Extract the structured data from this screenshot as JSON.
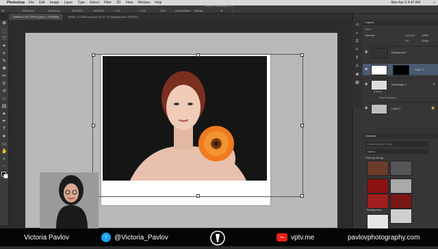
{
  "menubar": {
    "app": "Photoshop",
    "items": [
      "File",
      "Edit",
      "Image",
      "Layer",
      "Type",
      "Select",
      "Filter",
      "3D",
      "View",
      "Window",
      "Help"
    ],
    "clock": "Mon Apr 6 9:47 AM"
  },
  "options": {
    "app_title": "Adobe Photoshop 2020",
    "x": "758.50 px",
    "y": "418.50 px",
    "w": "100.00%",
    "h": "100.00%",
    "angle": "0.00",
    "h_skew": "0.00",
    "v_skew": "0.00",
    "interpolation_label": "Interpolation:",
    "interpolation": "Bicubic"
  },
  "tabs": [
    {
      "label": "Untitled-1 @ 100% (Layer 1, RGB/8#)",
      "active": true
    },
    {
      "label": "Studio_H-1808 copy.psd @ 16.7% (Background, RGB/8*)",
      "active": false
    }
  ],
  "layers_panel": {
    "title": "Layers",
    "kind": "Kind",
    "blend": "Normal",
    "opacity_label": "Opacity:",
    "opacity": "100%",
    "fill_label": "Fill:",
    "fill": "100%",
    "layers": [
      {
        "name": "Background",
        "selected": false
      },
      {
        "name": "Layer 1",
        "selected": true
      },
      {
        "name": "Rectangle 1",
        "selected": false
      },
      {
        "name": "Layer 0",
        "selected": false
      }
    ],
    "effects_label": "Effects",
    "effect": "Drop Shadow"
  },
  "libraries_panel": {
    "title": "Libraries",
    "search_placeholder": "Search Adobe Stock",
    "library": "Demo",
    "view_by": "View by Group",
    "item_label": "Background"
  },
  "footer": {
    "name": "Victoria Pavlov",
    "twitter": "@Victoria_Pavlov",
    "youtube": "vptv.me",
    "website": "pavlovphotography.com"
  },
  "colors": {
    "twitter": "#1da1f2",
    "youtube": "#e62117",
    "flower": "#f07a1e",
    "selected_layer": "#4a5a70"
  }
}
